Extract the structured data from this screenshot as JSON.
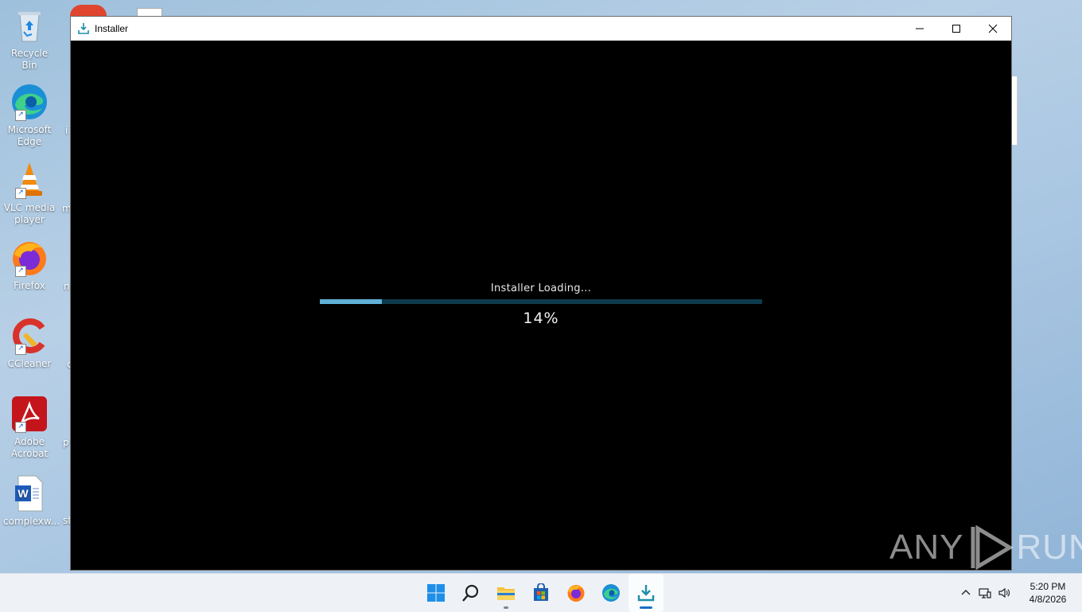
{
  "desktop": {
    "icons": [
      {
        "label": "Recycle Bin"
      },
      {
        "label": "Microsoft Edge"
      },
      {
        "label": "VLC media player"
      },
      {
        "label": "Firefox"
      },
      {
        "label": "CCleaner"
      },
      {
        "label": "Adobe Acrobat"
      },
      {
        "label": "complexw..."
      }
    ],
    "partial_labels": [
      "i",
      "m",
      "n",
      "c",
      "p",
      "st"
    ]
  },
  "window": {
    "title": "Installer",
    "loading_text": "Installer Loading...",
    "progress_percent": 14,
    "percent_label": "14%",
    "progress_fill_color": "#5fb0d6",
    "progress_track_color": "#0d3a4c"
  },
  "watermark": {
    "text_left": "ANY",
    "text_right": "RUN"
  },
  "taskbar": {
    "apps": [
      "start-icon",
      "search-icon",
      "file-explorer-icon",
      "store-icon",
      "firefox-icon",
      "edge-icon",
      "installer-icon"
    ],
    "clock": {
      "time": "5:20 PM",
      "date": "4/8/2026"
    }
  }
}
